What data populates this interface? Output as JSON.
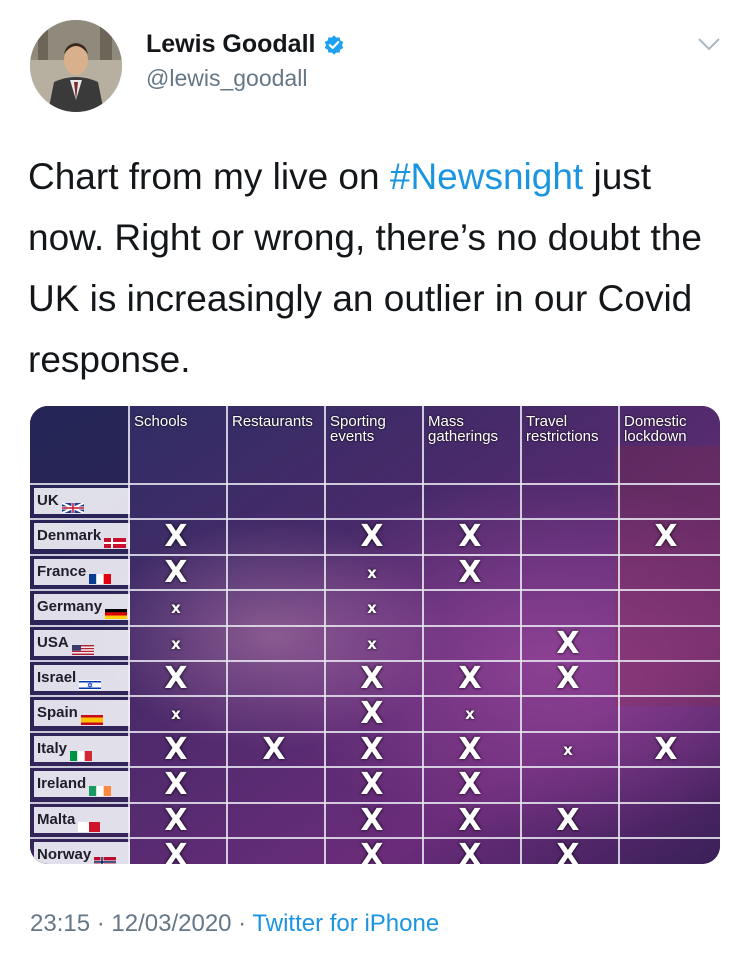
{
  "tweet": {
    "author_name": "Lewis Goodall",
    "handle": "@lewis_goodall",
    "text_before": "Chart from my live on ",
    "hashtag": "#Newsnight",
    "text_after": " just now. Right or wrong, there’s no doubt the UK is increasingly an outlier in our Covid response.",
    "time": "23:15",
    "separator": " · ",
    "date": "12/03/2020",
    "separator2": " · ",
    "source": "Twitter for iPhone"
  },
  "colors": {
    "hashtag": "#1b95e0",
    "verified": "#1da1f2",
    "muted": "#657786"
  },
  "icons": {
    "verified": "verified-badge-icon",
    "menu": "chevron-down-icon"
  },
  "chart_data": {
    "type": "table",
    "columns": [
      "Schools",
      "Restaurants",
      "Sporting\nevents",
      "Mass\ngatherings",
      "Travel\nrestrictions",
      "Domestic\nlockdown"
    ],
    "rows": [
      {
        "country": "UK",
        "marks": [
          "",
          "",
          "",
          "",
          "",
          ""
        ]
      },
      {
        "country": "Denmark",
        "marks": [
          "X",
          "",
          "X",
          "X",
          "",
          "X"
        ]
      },
      {
        "country": "France",
        "marks": [
          "X",
          "",
          "x",
          "X",
          "",
          ""
        ]
      },
      {
        "country": "Germany",
        "marks": [
          "x",
          "",
          "x",
          "",
          "",
          ""
        ]
      },
      {
        "country": "USA",
        "marks": [
          "x",
          "",
          "x",
          "",
          "X",
          ""
        ]
      },
      {
        "country": "Israel",
        "marks": [
          "X",
          "",
          "X",
          "X",
          "X",
          ""
        ]
      },
      {
        "country": "Spain",
        "marks": [
          "x",
          "",
          "X",
          "x",
          "",
          ""
        ]
      },
      {
        "country": "Italy",
        "marks": [
          "X",
          "X",
          "X",
          "X",
          "x",
          "X"
        ]
      },
      {
        "country": "Ireland",
        "marks": [
          "X",
          "",
          "X",
          "X",
          "",
          ""
        ]
      },
      {
        "country": "Malta",
        "marks": [
          "X",
          "",
          "X",
          "X",
          "X",
          ""
        ]
      },
      {
        "country": "Norway",
        "marks": [
          "X",
          "",
          "X",
          "X",
          "X",
          ""
        ]
      }
    ]
  }
}
